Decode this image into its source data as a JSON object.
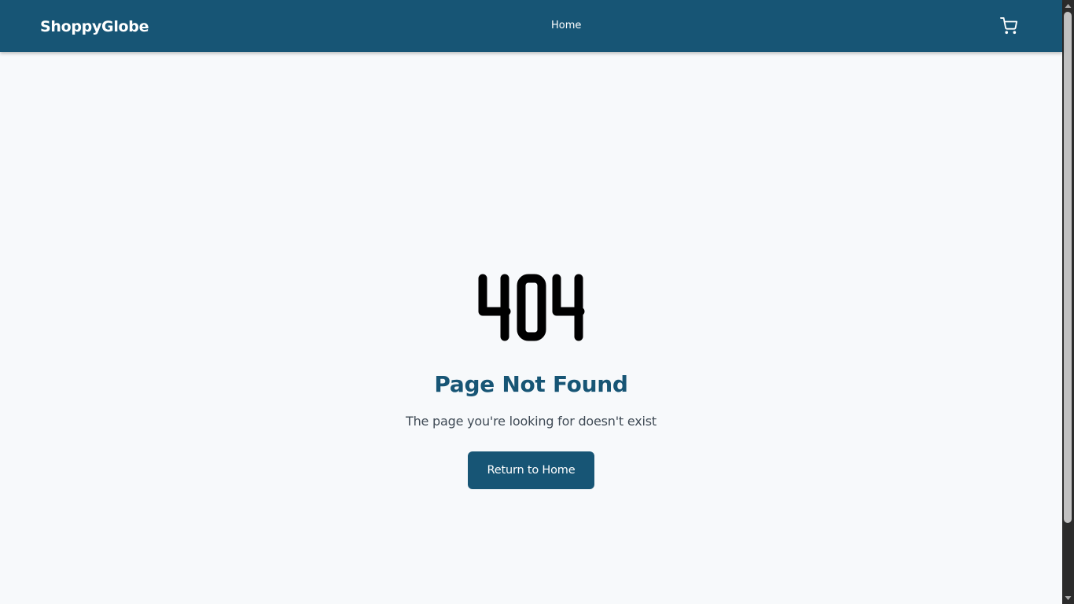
{
  "header": {
    "brand": "ShoppyGlobe",
    "nav": [
      {
        "label": "Home"
      }
    ],
    "cart_icon": "shopping-cart-icon"
  },
  "main": {
    "error_code": "404",
    "title": "Page Not Found",
    "message": "The page you're looking for doesn't exist",
    "button_label": "Return to Home"
  },
  "colors": {
    "navbar": "#175575",
    "accent": "#175575",
    "background": "#f7f9fb",
    "message_text": "#3f4a55",
    "error_code": "#000000"
  }
}
